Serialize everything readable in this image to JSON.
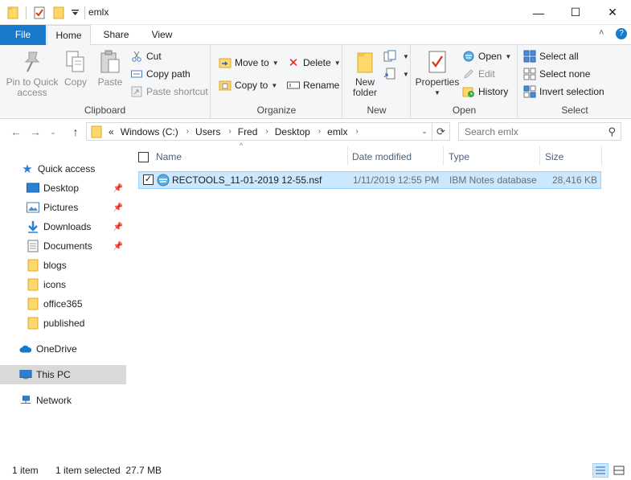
{
  "window": {
    "title": "emlx",
    "minimize_glyph": "—",
    "maximize_glyph": "☐",
    "close_glyph": "✕"
  },
  "ribbon_tabs": {
    "file": "File",
    "home": "Home",
    "share": "Share",
    "view": "View",
    "collapse_glyph": "˄",
    "help_glyph": "?"
  },
  "ribbon": {
    "clipboard": {
      "label": "Clipboard",
      "pin_label_1": "Pin to Quick",
      "pin_label_2": "access",
      "copy": "Copy",
      "paste": "Paste",
      "cut": "Cut",
      "copy_path": "Copy path",
      "paste_shortcut": "Paste shortcut"
    },
    "organize": {
      "label": "Organize",
      "move_to": "Move to",
      "copy_to": "Copy to",
      "delete": "Delete",
      "rename": "Rename"
    },
    "new": {
      "label": "New",
      "new_folder_1": "New",
      "new_folder_2": "folder"
    },
    "open": {
      "label": "Open",
      "properties": "Properties",
      "open": "Open",
      "edit": "Edit",
      "history": "History"
    },
    "select": {
      "label": "Select",
      "select_all": "Select all",
      "select_none": "Select none",
      "invert_selection": "Invert selection"
    }
  },
  "address": {
    "overflow": "«",
    "crumbs": [
      "Windows (C:)",
      "Users",
      "Fred",
      "Desktop",
      "emlx"
    ],
    "separator": "›",
    "search_placeholder": "Search emlx"
  },
  "nav": {
    "quick_access": "Quick access",
    "items": [
      "Desktop",
      "Pictures",
      "Downloads",
      "Documents",
      "blogs",
      "icons",
      "office365",
      "published"
    ],
    "onedrive": "OneDrive",
    "this_pc": "This PC",
    "network": "Network"
  },
  "columns": {
    "name": "Name",
    "date_modified": "Date modified",
    "type": "Type",
    "size": "Size"
  },
  "files": [
    {
      "name": "RECTOOLS_11-01-2019 12-55.nsf",
      "date_modified": "1/11/2019 12:55 PM",
      "type": "IBM Notes database",
      "size": "28,416 KB",
      "selected": true
    }
  ],
  "status": {
    "count": "1 item",
    "selection": "1 item selected  27.7 MB"
  },
  "colors": {
    "accent": "#1979ca",
    "selection_bg": "#cce8ff",
    "selection_border": "#99d1ff",
    "folder_yellow": "#ffd86b",
    "header_text": "#4c607a"
  },
  "icons": {
    "folder": "folder-icon",
    "nsf": "notes-database-icon"
  }
}
